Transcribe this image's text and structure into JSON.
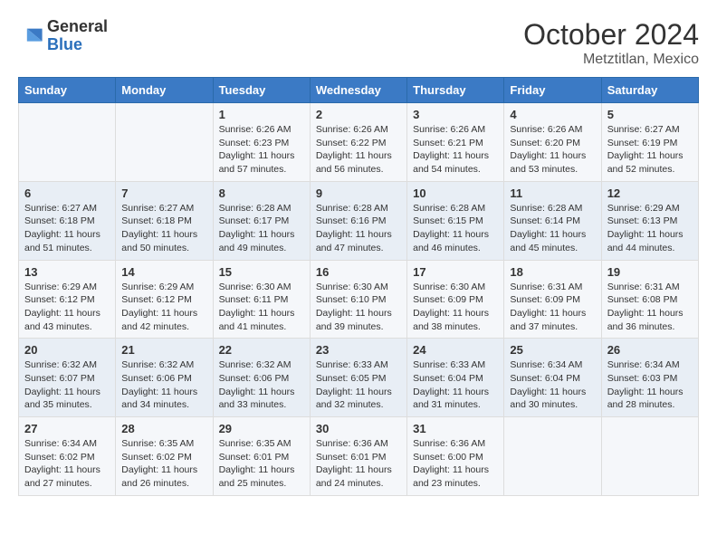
{
  "header": {
    "logo_general": "General",
    "logo_blue": "Blue",
    "month_year": "October 2024",
    "location": "Metztitlan, Mexico"
  },
  "days_of_week": [
    "Sunday",
    "Monday",
    "Tuesday",
    "Wednesday",
    "Thursday",
    "Friday",
    "Saturday"
  ],
  "weeks": [
    [
      {
        "day": "",
        "info": ""
      },
      {
        "day": "",
        "info": ""
      },
      {
        "day": "1",
        "info": "Sunrise: 6:26 AM\nSunset: 6:23 PM\nDaylight: 11 hours and 57 minutes."
      },
      {
        "day": "2",
        "info": "Sunrise: 6:26 AM\nSunset: 6:22 PM\nDaylight: 11 hours and 56 minutes."
      },
      {
        "day": "3",
        "info": "Sunrise: 6:26 AM\nSunset: 6:21 PM\nDaylight: 11 hours and 54 minutes."
      },
      {
        "day": "4",
        "info": "Sunrise: 6:26 AM\nSunset: 6:20 PM\nDaylight: 11 hours and 53 minutes."
      },
      {
        "day": "5",
        "info": "Sunrise: 6:27 AM\nSunset: 6:19 PM\nDaylight: 11 hours and 52 minutes."
      }
    ],
    [
      {
        "day": "6",
        "info": "Sunrise: 6:27 AM\nSunset: 6:18 PM\nDaylight: 11 hours and 51 minutes."
      },
      {
        "day": "7",
        "info": "Sunrise: 6:27 AM\nSunset: 6:18 PM\nDaylight: 11 hours and 50 minutes."
      },
      {
        "day": "8",
        "info": "Sunrise: 6:28 AM\nSunset: 6:17 PM\nDaylight: 11 hours and 49 minutes."
      },
      {
        "day": "9",
        "info": "Sunrise: 6:28 AM\nSunset: 6:16 PM\nDaylight: 11 hours and 47 minutes."
      },
      {
        "day": "10",
        "info": "Sunrise: 6:28 AM\nSunset: 6:15 PM\nDaylight: 11 hours and 46 minutes."
      },
      {
        "day": "11",
        "info": "Sunrise: 6:28 AM\nSunset: 6:14 PM\nDaylight: 11 hours and 45 minutes."
      },
      {
        "day": "12",
        "info": "Sunrise: 6:29 AM\nSunset: 6:13 PM\nDaylight: 11 hours and 44 minutes."
      }
    ],
    [
      {
        "day": "13",
        "info": "Sunrise: 6:29 AM\nSunset: 6:12 PM\nDaylight: 11 hours and 43 minutes."
      },
      {
        "day": "14",
        "info": "Sunrise: 6:29 AM\nSunset: 6:12 PM\nDaylight: 11 hours and 42 minutes."
      },
      {
        "day": "15",
        "info": "Sunrise: 6:30 AM\nSunset: 6:11 PM\nDaylight: 11 hours and 41 minutes."
      },
      {
        "day": "16",
        "info": "Sunrise: 6:30 AM\nSunset: 6:10 PM\nDaylight: 11 hours and 39 minutes."
      },
      {
        "day": "17",
        "info": "Sunrise: 6:30 AM\nSunset: 6:09 PM\nDaylight: 11 hours and 38 minutes."
      },
      {
        "day": "18",
        "info": "Sunrise: 6:31 AM\nSunset: 6:09 PM\nDaylight: 11 hours and 37 minutes."
      },
      {
        "day": "19",
        "info": "Sunrise: 6:31 AM\nSunset: 6:08 PM\nDaylight: 11 hours and 36 minutes."
      }
    ],
    [
      {
        "day": "20",
        "info": "Sunrise: 6:32 AM\nSunset: 6:07 PM\nDaylight: 11 hours and 35 minutes."
      },
      {
        "day": "21",
        "info": "Sunrise: 6:32 AM\nSunset: 6:06 PM\nDaylight: 11 hours and 34 minutes."
      },
      {
        "day": "22",
        "info": "Sunrise: 6:32 AM\nSunset: 6:06 PM\nDaylight: 11 hours and 33 minutes."
      },
      {
        "day": "23",
        "info": "Sunrise: 6:33 AM\nSunset: 6:05 PM\nDaylight: 11 hours and 32 minutes."
      },
      {
        "day": "24",
        "info": "Sunrise: 6:33 AM\nSunset: 6:04 PM\nDaylight: 11 hours and 31 minutes."
      },
      {
        "day": "25",
        "info": "Sunrise: 6:34 AM\nSunset: 6:04 PM\nDaylight: 11 hours and 30 minutes."
      },
      {
        "day": "26",
        "info": "Sunrise: 6:34 AM\nSunset: 6:03 PM\nDaylight: 11 hours and 28 minutes."
      }
    ],
    [
      {
        "day": "27",
        "info": "Sunrise: 6:34 AM\nSunset: 6:02 PM\nDaylight: 11 hours and 27 minutes."
      },
      {
        "day": "28",
        "info": "Sunrise: 6:35 AM\nSunset: 6:02 PM\nDaylight: 11 hours and 26 minutes."
      },
      {
        "day": "29",
        "info": "Sunrise: 6:35 AM\nSunset: 6:01 PM\nDaylight: 11 hours and 25 minutes."
      },
      {
        "day": "30",
        "info": "Sunrise: 6:36 AM\nSunset: 6:01 PM\nDaylight: 11 hours and 24 minutes."
      },
      {
        "day": "31",
        "info": "Sunrise: 6:36 AM\nSunset: 6:00 PM\nDaylight: 11 hours and 23 minutes."
      },
      {
        "day": "",
        "info": ""
      },
      {
        "day": "",
        "info": ""
      }
    ]
  ]
}
